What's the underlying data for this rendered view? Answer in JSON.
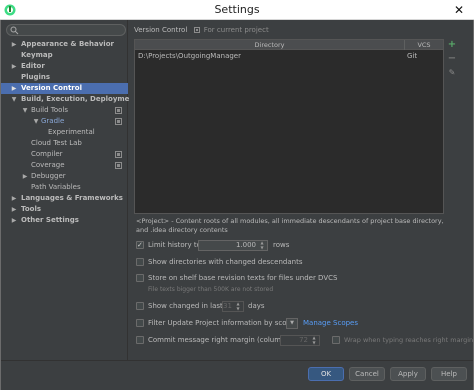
{
  "window": {
    "title": "Settings",
    "close_glyph": "✕"
  },
  "search": {
    "placeholder": "",
    "value": ""
  },
  "tree": [
    {
      "label": "Appearance & Behavior",
      "arrow": "▶",
      "bold": true
    },
    {
      "label": "Keymap",
      "arrow": "",
      "bold": true
    },
    {
      "label": "Editor",
      "arrow": "▶",
      "bold": true
    },
    {
      "label": "Plugins",
      "arrow": "",
      "bold": true
    },
    {
      "label": "Version Control",
      "arrow": "▶",
      "bold": true,
      "selected": true
    },
    {
      "label": "Build, Execution, Deployment",
      "arrow": "▼",
      "bold": true
    },
    {
      "label": "Build Tools",
      "arrow": "▼",
      "project": true
    },
    {
      "label": "Gradle",
      "arrow": "▼",
      "project": true,
      "blue": true
    },
    {
      "label": "Experimental",
      "arrow": ""
    },
    {
      "label": "Cloud Test Lab",
      "arrow": ""
    },
    {
      "label": "Compiler",
      "arrow": "",
      "project": true
    },
    {
      "label": "Coverage",
      "arrow": "",
      "project": true
    },
    {
      "label": "Debugger",
      "arrow": "▶"
    },
    {
      "label": "Path Variables",
      "arrow": ""
    },
    {
      "label": "Languages & Frameworks",
      "arrow": "▶",
      "bold": true
    },
    {
      "label": "Tools",
      "arrow": "▶",
      "bold": true
    },
    {
      "label": "Other Settings",
      "arrow": "▶",
      "bold": true
    }
  ],
  "main": {
    "breadcrumb": {
      "section": "Version Control",
      "scope": "For current project"
    },
    "table": {
      "columns": [
        "Directory",
        "VCS"
      ],
      "rows": [
        {
          "directory": "D:\\Projects\\OutgoingManager",
          "vcs": "Git"
        }
      ]
    },
    "tools": {
      "add": "+",
      "remove": "−",
      "edit": "✎"
    },
    "note": "<Project> - Content roots of all modules, all immediate descendants of project base directory, and .idea directory contents",
    "options": {
      "limit_history": {
        "label": "Limit history to:",
        "value": "1.000",
        "suffix": "rows",
        "checked": true
      },
      "show_changed_dirs": {
        "label": "Show directories with changed descendants",
        "checked": false
      },
      "store_shelf": {
        "label": "Store on shelf base revision texts for files under DVCS",
        "checked": false,
        "hint": "File texts bigger than 500K are not stored"
      },
      "show_changed_last": {
        "label": "Show changed in last",
        "value": "31",
        "suffix": "days",
        "checked": false
      },
      "filter_update": {
        "label": "Filter Update Project information by scope",
        "link": "Manage Scopes",
        "checked": false
      },
      "commit_margin": {
        "label": "Commit message right margin (columns):",
        "value": "72",
        "checked": false,
        "wrap_label": "Wrap when typing reaches right margin",
        "wrap_checked": false
      }
    }
  },
  "buttons": {
    "ok": "OK",
    "cancel": "Cancel",
    "apply": "Apply",
    "help": "Help"
  }
}
